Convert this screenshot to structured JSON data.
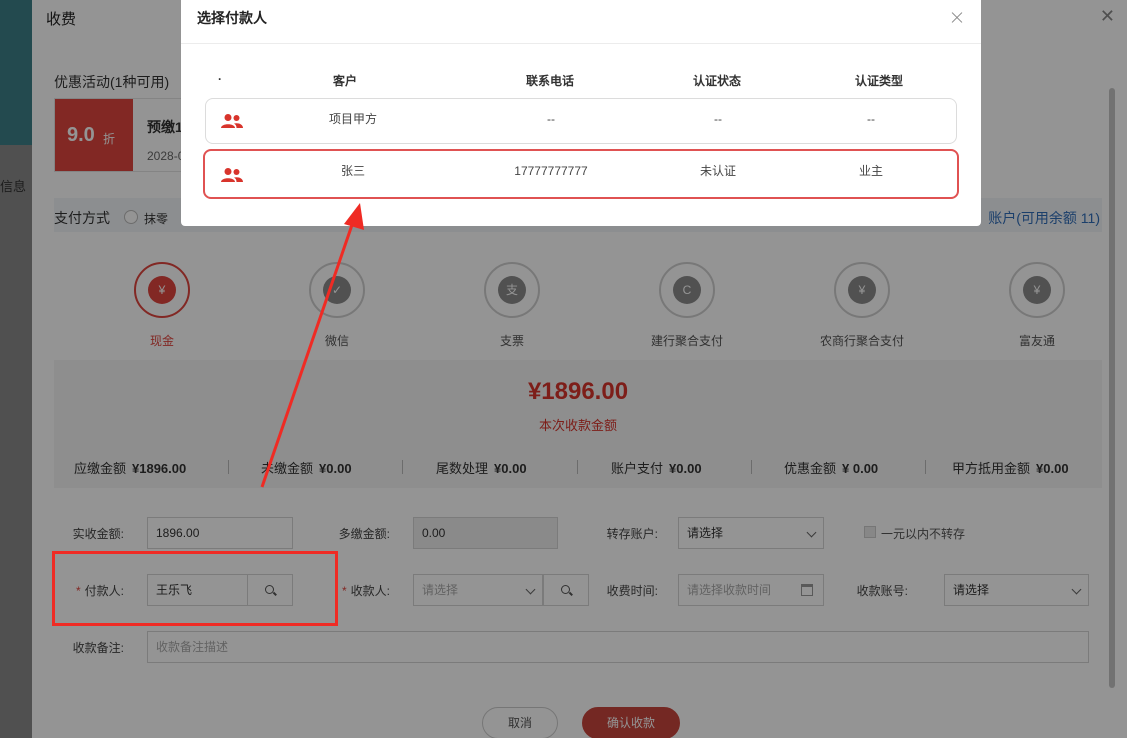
{
  "background": {
    "side_label": "信息"
  },
  "fee_dialog": {
    "title": "收费",
    "promo": {
      "label": "优惠活动(1种可用)",
      "discount_value": "9.0",
      "discount_unit": "折",
      "name": "预缴1",
      "date": "2028-0"
    },
    "payment": {
      "label": "支付方式",
      "round_option": "抹零",
      "account_text": "账户(可用余额 11)"
    },
    "methods": [
      {
        "label": "现金",
        "icon": "money-bag-icon",
        "glyph": "¥",
        "active": true
      },
      {
        "label": "微信",
        "icon": "wechat-icon",
        "glyph": "✓",
        "active": false
      },
      {
        "label": "支票",
        "icon": "cheque-icon",
        "glyph": "支",
        "active": false
      },
      {
        "label": "建行聚合支付",
        "icon": "ccb-icon",
        "glyph": "C",
        "active": false
      },
      {
        "label": "农商行聚合支付",
        "icon": "hand-coin-icon",
        "glyph": "¥",
        "active": false
      },
      {
        "label": "富友通",
        "icon": "money-bag-icon",
        "glyph": "¥",
        "active": false
      }
    ],
    "amount": {
      "total": "¥1896.00",
      "total_label": "本次收款金额",
      "stats": [
        {
          "label": "应缴金额",
          "value": "¥1896.00"
        },
        {
          "label": "未缴金额",
          "value": "¥0.00"
        },
        {
          "label": "尾数处理",
          "value": "¥0.00"
        },
        {
          "label": "账户支付",
          "value": "¥0.00"
        },
        {
          "label": "优惠金额",
          "value": "¥ 0.00"
        },
        {
          "label": "甲方抵用金额",
          "value": "¥0.00"
        }
      ]
    },
    "form": {
      "actual_label": "实收金额:",
      "actual_value": "1896.00",
      "over_label": "多缴金额:",
      "over_value": "0.00",
      "transfer_label": "转存账户:",
      "transfer_value": "请选择",
      "no_transfer_label": "一元以内不转存",
      "payer_required": "*",
      "payer_label": "付款人:",
      "payer_value": "王乐飞",
      "payee_required": "*",
      "payee_label": "收款人:",
      "payee_placeholder": "请选择",
      "time_label": "收费时间:",
      "time_placeholder": "请选择收款时间",
      "account_label": "收款账号:",
      "account_value": "请选择",
      "remark_label": "收款备注:",
      "remark_placeholder": "收款备注描述"
    },
    "buttons": {
      "cancel": "取消",
      "confirm": "确认收款"
    }
  },
  "payer_modal": {
    "title": "选择付款人",
    "headers": {
      "dot": "·",
      "customer": "客户",
      "phone": "联系电话",
      "auth_status": "认证状态",
      "auth_type": "认证类型"
    },
    "rows": [
      {
        "customer": "项目甲方",
        "phone": "--",
        "auth_status": "--",
        "auth_type": "--",
        "selected": false
      },
      {
        "customer": "张三",
        "phone": "17777777777",
        "auth_status": "未认证",
        "auth_type": "业主",
        "selected": true
      }
    ]
  },
  "colors": {
    "accent_red": "#e0463f",
    "annotation_red": "#ef2b24",
    "link_blue": "#2f6db8"
  }
}
